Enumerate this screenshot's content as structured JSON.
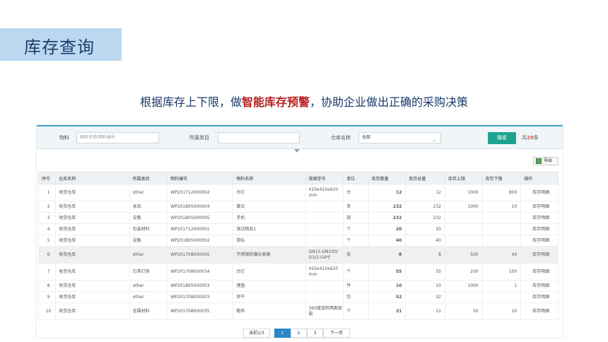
{
  "slide": {
    "title": "库存查询",
    "subtitle_pre": "根据库存上下限，做",
    "subtitle_highlight": "智能库存预警",
    "subtitle_post": "，协助企业做出正确的采购决策"
  },
  "filters": {
    "material_label": "物料",
    "material_placeholder": "物料名称/物料编号",
    "category_label": "所属类目",
    "category_value": "",
    "warehouse_label": "仓库名称",
    "warehouse_value": "全部",
    "search_label": "搜索",
    "count_pre": "共",
    "count_num": "29",
    "count_post": "条"
  },
  "toolbar": {
    "export_label": "导出"
  },
  "table": {
    "headers": [
      "序号",
      "仓库名称",
      "所属类目",
      "物料编号",
      "物料名称",
      "规格型号",
      "单位",
      "库存数量",
      "库存总量",
      "库存上限",
      "库存下限",
      "操作"
    ],
    "rows": [
      [
        "1",
        "收货仓库",
        "other",
        "WP201712000002",
        "台灯",
        "410x410x620 mm",
        "台",
        "12",
        "12",
        "1000",
        "800",
        "库存明细"
      ],
      [
        "2",
        "收货仓库",
        "食品",
        "WP201805000004",
        "黄瓜",
        "",
        "条",
        "232",
        "232",
        "1000",
        "10",
        "库存明细"
      ],
      [
        "3",
        "收货仓库",
        "设备",
        "WP201805000005",
        "手机",
        "",
        "部",
        "232",
        "232",
        "",
        "",
        "库存明细"
      ],
      [
        "4",
        "收货仓库",
        "包装材料",
        "WP201712000001",
        "测试物品1",
        "",
        "个",
        "20",
        "20",
        "",
        "",
        "库存明细"
      ],
      [
        "5",
        "收货仓库",
        "设备",
        "WP201805000002",
        "鼠标",
        "",
        "个",
        "40",
        "40",
        "",
        "",
        "库存明细"
      ],
      [
        "6",
        "收货仓库",
        "other",
        "WP201708000005",
        "不锈钢防爆仪表箱",
        "DN15-DN100/ G1/2-G4寸",
        "条",
        "8",
        "8",
        "500",
        "40",
        "库存明细"
      ],
      [
        "7",
        "收货仓库",
        "灯具灯饰",
        "WP201708000034",
        "台灯",
        "410x410x620 mm",
        "个",
        "55",
        "55",
        "200",
        "100",
        "库存明细"
      ],
      [
        "8",
        "收货仓库",
        "other",
        "WP201805000003",
        "键盘",
        "",
        "件",
        "10",
        "10",
        "1000",
        "1",
        "库存明细"
      ],
      [
        "9",
        "收货仓库",
        "other",
        "WP201708000003",
        "饼干",
        "",
        "包",
        "52",
        "52",
        "",
        "",
        "库存明细"
      ],
      [
        "10",
        "收货仓库",
        "金属材料",
        "WP201708000035",
        "鞋柜",
        "360度旋转两面放鞋",
        "个",
        "21",
        "21",
        "50",
        "20",
        "库存明细"
      ]
    ]
  },
  "pagination": {
    "summary": "当前1/3",
    "pages": [
      "1",
      "2",
      "3"
    ],
    "next": "下一页",
    "current": "1"
  }
}
